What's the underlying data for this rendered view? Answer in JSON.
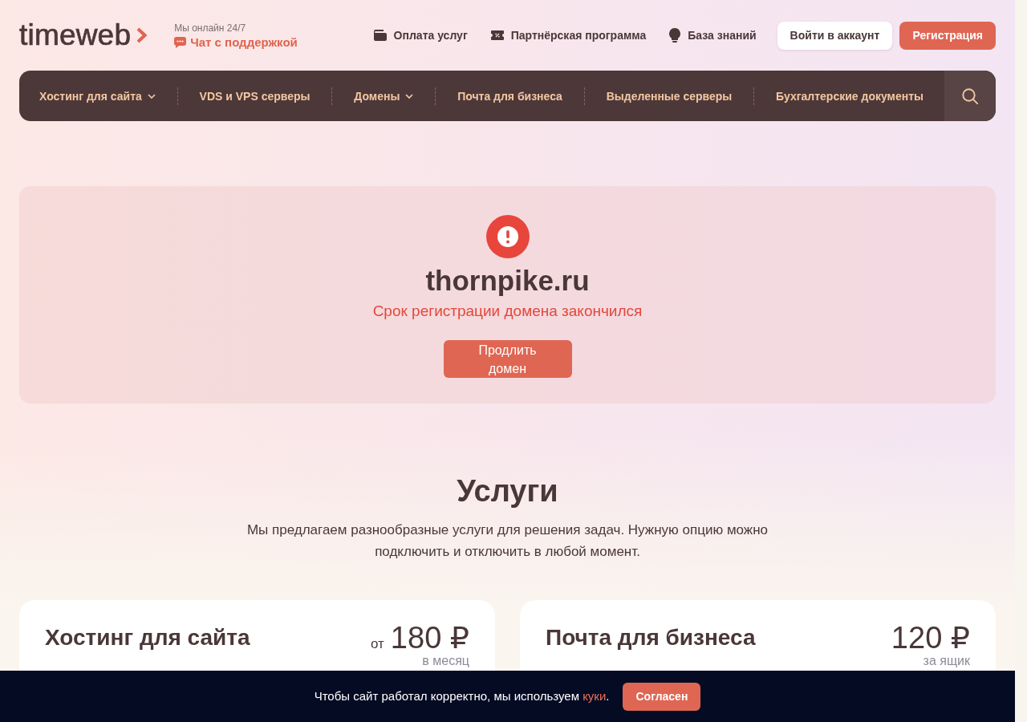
{
  "header": {
    "logo": "timeweb",
    "online_note": "Мы онлайн 24/7",
    "support_link": "Чат с поддержкой",
    "links": [
      "Оплата услуг",
      "Партнёрская программа",
      "База знаний"
    ],
    "buttons": [
      {
        "label": "Войти в аккаунт",
        "kind": "secondary"
      },
      {
        "label": "Регистрация",
        "kind": "primary"
      }
    ]
  },
  "nav": {
    "items": [
      {
        "label": "Хостинг для сайта",
        "has_submenu": true
      },
      {
        "label": "VDS и VPS серверы",
        "has_submenu": false
      },
      {
        "label": "Домены",
        "has_submenu": true
      },
      {
        "label": "Почта для бизнеса",
        "has_submenu": false
      },
      {
        "label": "Выделенные серверы",
        "has_submenu": false
      },
      {
        "label": "Бухгалтерские документы",
        "has_submenu": false
      }
    ]
  },
  "domain_status": {
    "domain": "thornpike.ru",
    "message": "Срок регистрации домена закончился",
    "button": "Продлить домен"
  },
  "services": {
    "title": "Услуги",
    "description": "Мы предлагаем разнообразные услуги для решения задач. Нужную опцию можно подключить и отключить в любой момент.",
    "cards": [
      {
        "title": "Хостинг для сайта",
        "price_prefix": "от",
        "price": "180 ₽",
        "period": "в месяц"
      },
      {
        "title": "Почта для бизнеса",
        "price": "120 ₽",
        "period": "за ящик"
      }
    ]
  },
  "cookie_banner": {
    "message": [
      {
        "kind": "text",
        "text": "Чтобы сайт работал корректно, мы используем "
      },
      {
        "kind": "link",
        "text": "куки"
      },
      {
        "kind": "text",
        "text": "."
      }
    ],
    "button": "Согласен"
  }
}
